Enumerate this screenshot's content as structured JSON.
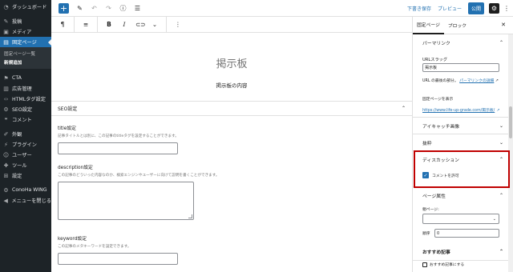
{
  "admin_menu": {
    "items": [
      {
        "label": "ダッシュボード",
        "icon": "dashboard-icon",
        "glyph": "◔"
      },
      {
        "label": "投稿",
        "icon": "pin-icon",
        "glyph": "✎"
      },
      {
        "label": "メディア",
        "icon": "media-icon",
        "glyph": "▣"
      },
      {
        "label": "固定ページ",
        "icon": "page-icon",
        "glyph": "▤"
      }
    ],
    "submenu": [
      {
        "label": "固定ページ一覧"
      },
      {
        "label": "新規追加"
      }
    ],
    "items_after": [
      {
        "label": "CTA",
        "icon": "cta-icon",
        "glyph": "⚑"
      },
      {
        "label": "広告管理",
        "icon": "ads-icon",
        "glyph": "▥"
      },
      {
        "label": "HTMLタグ設定",
        "icon": "code-icon",
        "glyph": "‹›"
      },
      {
        "label": "SEO設定",
        "icon": "seo-icon",
        "glyph": "⚙"
      },
      {
        "label": "コメント",
        "icon": "comment-icon",
        "glyph": "❝"
      }
    ],
    "items_lower": [
      {
        "label": "外観",
        "icon": "appearance-icon",
        "glyph": "✐"
      },
      {
        "label": "プラグイン",
        "icon": "plugin-icon",
        "glyph": "⚡"
      },
      {
        "label": "ユーザー",
        "icon": "user-icon",
        "glyph": "☺"
      },
      {
        "label": "ツール",
        "icon": "tools-icon",
        "glyph": "✚"
      },
      {
        "label": "設定",
        "icon": "settings-icon",
        "glyph": "⊞"
      }
    ],
    "items_bottom": [
      {
        "label": "ConoHa WING",
        "icon": "conoha-icon",
        "glyph": "⚙"
      },
      {
        "label": "メニューを閉じる",
        "icon": "collapse-icon",
        "glyph": "◀"
      }
    ]
  },
  "header": {
    "draft": "下書き保存",
    "preview": "プレビュー",
    "publish": "公開"
  },
  "canvas": {
    "title": "掲示板",
    "content": "掲示板の内容"
  },
  "seo": {
    "heading": "SEO設定",
    "title_label": "title設定",
    "title_help": "記事タイトルとは別に、この記事のtitleタグを設定することができます。",
    "description_label": "description設定",
    "description_help": "この記事のどういった内容なのか、検索エンジンやユーザーに向けて説明を書くことができます。",
    "keyword_label": "keyword設定",
    "keyword_help": "この記事のメタキーワードを設定できます。"
  },
  "sidebar": {
    "tabs": [
      "固定ページ",
      "ブロック"
    ],
    "permalink": {
      "heading": "パーマリンク",
      "slug_label": "URLスラッグ",
      "slug_value": "掲示板",
      "help_text": "URL の最後の部分。",
      "help_link": "パーマリンクの詳細",
      "view_label": "固定ページを表示",
      "url": "https://www.life-up-grade.com/掲示板/"
    },
    "featured_image": "アイキャッチ画像",
    "excerpt": "抜粋",
    "discussion": {
      "heading": "ディスカッション",
      "allow_comments": "コメントを許可"
    },
    "page_attributes": {
      "heading": "ページ属性",
      "parent_label": "親ページ:",
      "order_label": "順序",
      "order_value": "0"
    },
    "recommended": {
      "heading": "おすすめ記事",
      "checkbox_label": "おすすめ記事にする"
    }
  }
}
